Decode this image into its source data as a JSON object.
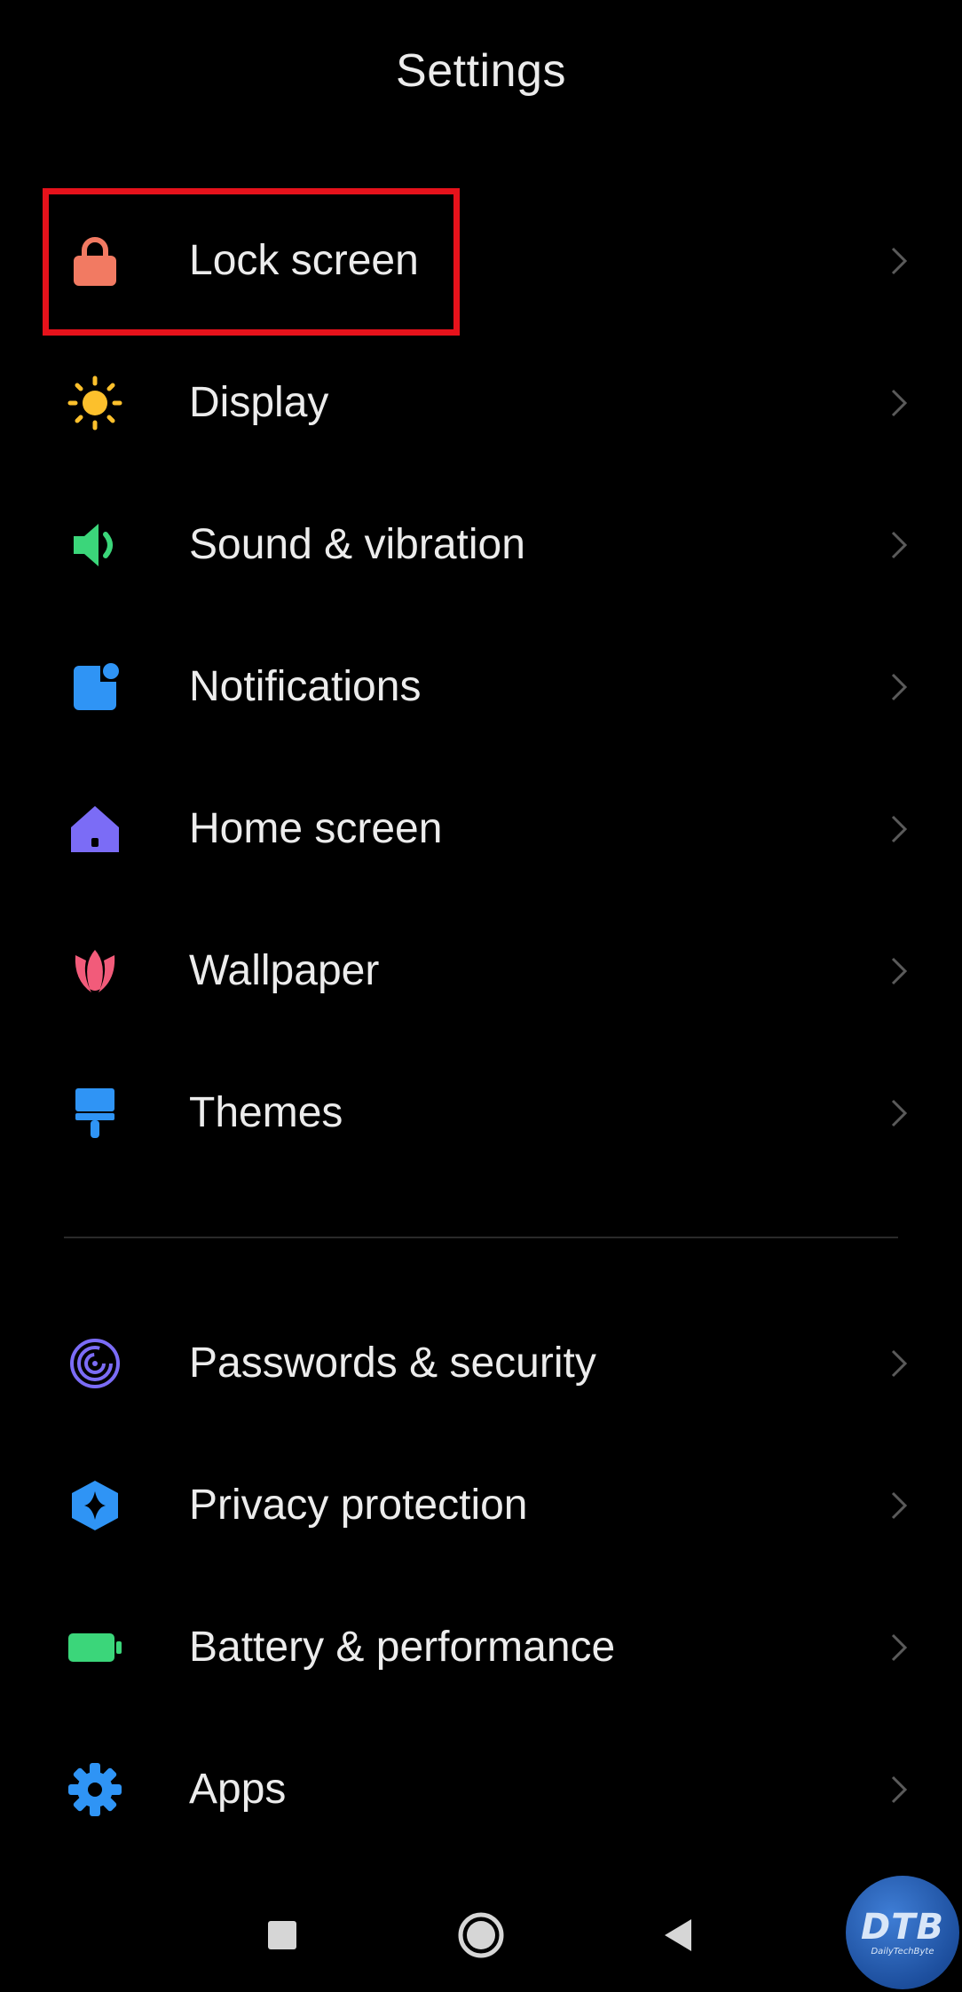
{
  "header": {
    "title": "Settings"
  },
  "group1": [
    {
      "label": "Lock screen",
      "icon": "lock-icon",
      "color": "#f27a62"
    },
    {
      "label": "Display",
      "icon": "sun-icon",
      "color": "#fcc02c"
    },
    {
      "label": "Sound & vibration",
      "icon": "speaker-icon",
      "color": "#3bd67a"
    },
    {
      "label": "Notifications",
      "icon": "notification-icon",
      "color": "#2f94f5"
    },
    {
      "label": "Home screen",
      "icon": "home-icon",
      "color": "#7b6cf6"
    },
    {
      "label": "Wallpaper",
      "icon": "tulip-icon",
      "color": "#f25b7a"
    },
    {
      "label": "Themes",
      "icon": "paint-brush-icon",
      "color": "#2f94f5"
    }
  ],
  "group2": [
    {
      "label": "Passwords & security",
      "icon": "fingerprint-icon",
      "color": "#7b6cf6"
    },
    {
      "label": "Privacy protection",
      "icon": "privacy-shield-icon",
      "color": "#2f94f5"
    },
    {
      "label": "Battery & performance",
      "icon": "battery-icon",
      "color": "#3bd67a"
    },
    {
      "label": "Apps",
      "icon": "gear-icon",
      "color": "#2f94f5"
    }
  ],
  "highlight": {
    "color": "#e6121b"
  },
  "navbar": {
    "recents": "recents-icon",
    "home": "home-nav-icon",
    "back": "back-icon"
  },
  "watermark": {
    "main": "DTB",
    "sub": "DailyTechByte"
  }
}
